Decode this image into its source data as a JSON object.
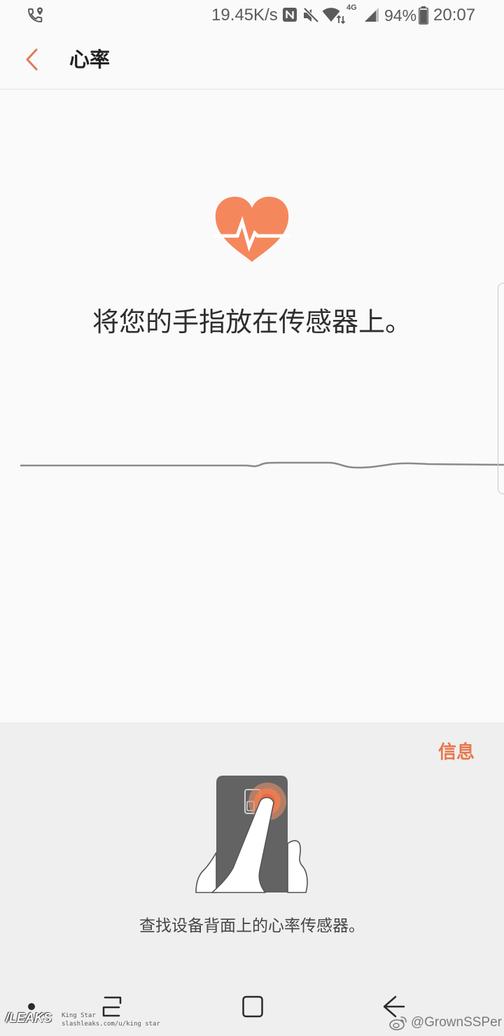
{
  "status_bar": {
    "call_icon": "phone-location-icon",
    "network_speed": "19.45K/s",
    "nfc_icon": "nfc-icon",
    "mute_icon": "mute-icon",
    "wifi_icon": "wifi-icon",
    "network_type": "4G",
    "signal_icon": "signal-icon",
    "battery_percent": "94%",
    "battery_level": 0.94,
    "time": "20:07"
  },
  "header": {
    "back_icon": "chevron-left-icon",
    "title": "心率"
  },
  "measure": {
    "heart_icon": "heart-pulse-icon",
    "instruction": "将您的手指放在传感器上。"
  },
  "sensor_panel": {
    "info_link": "信息",
    "illustration": "finger-on-rear-sensor-illustration",
    "hint": "查找设备背面上的心率传感器。"
  },
  "nav_bar": {
    "icons": [
      "nav-dot-icon",
      "recent-apps-icon",
      "home-icon",
      "back-arrow-icon"
    ]
  },
  "watermarks": {
    "logo": "/LEAKS",
    "author": "King Star",
    "url": "slashleaks.com/u/king star",
    "weibo_icon": "weibo-icon",
    "weibo_handle": "@GrownSSPer"
  },
  "colors": {
    "accent": "#e8774e",
    "heart": "#f5875d",
    "background": "#fafafa",
    "panel": "#efefef",
    "text": "#2e2e2e"
  }
}
